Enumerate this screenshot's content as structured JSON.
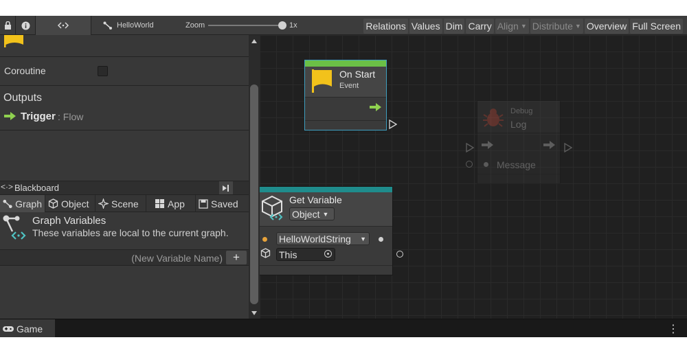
{
  "toolbar": {
    "graph_name": "HelloWorld",
    "zoom_label": "Zoom",
    "zoom_value_text": "1x",
    "zoom_level": 1.0,
    "buttons": [
      {
        "label": "Relations",
        "enabled": true
      },
      {
        "label": "Values",
        "enabled": true
      },
      {
        "label": "Dim",
        "enabled": true
      },
      {
        "label": "Carry",
        "enabled": true
      },
      {
        "label": "Align",
        "enabled": false
      },
      {
        "label": "Distribute",
        "enabled": false
      },
      {
        "label": "Overview",
        "enabled": true
      },
      {
        "label": "Full Screen",
        "enabled": true
      }
    ]
  },
  "inspector": {
    "coroutine_label": "Coroutine",
    "coroutine_checked": false,
    "outputs_header": "Outputs",
    "trigger_name": "Trigger",
    "trigger_type": ": Flow"
  },
  "blackboard": {
    "title": "Blackboard",
    "tabs": [
      {
        "label": "Graph",
        "icon": "graph-icon",
        "active": true
      },
      {
        "label": "Object",
        "icon": "cube-icon",
        "active": false
      },
      {
        "label": "Scene",
        "icon": "scene-icon",
        "active": false
      },
      {
        "label": "App",
        "icon": "app-icon",
        "active": false
      },
      {
        "label": "Saved",
        "icon": "saved-icon",
        "active": false
      }
    ],
    "section_title": "Graph Variables",
    "section_desc": "These variables are local to the current graph.",
    "new_var_placeholder": "(New Variable Name)",
    "add_label": "+"
  },
  "nodes": {
    "on_start": {
      "title": "On Start",
      "subtitle": "Event",
      "accent": "#6bc046"
    },
    "debug_log": {
      "title_small": "Debug",
      "title": "Log",
      "message_label": "Message"
    },
    "get_variable": {
      "title": "Get Variable",
      "kind_dropdown": "Object",
      "name_dropdown": "HelloWorldString",
      "target_field": "This",
      "accent": "#1f8c8c"
    }
  },
  "bottom": {
    "game_tab": "Game",
    "menu_icon": "⋮"
  },
  "colors": {
    "flow_arrow": "#8fd14f",
    "flag": "#f2c21b",
    "port_orange": "#e8a33a"
  }
}
